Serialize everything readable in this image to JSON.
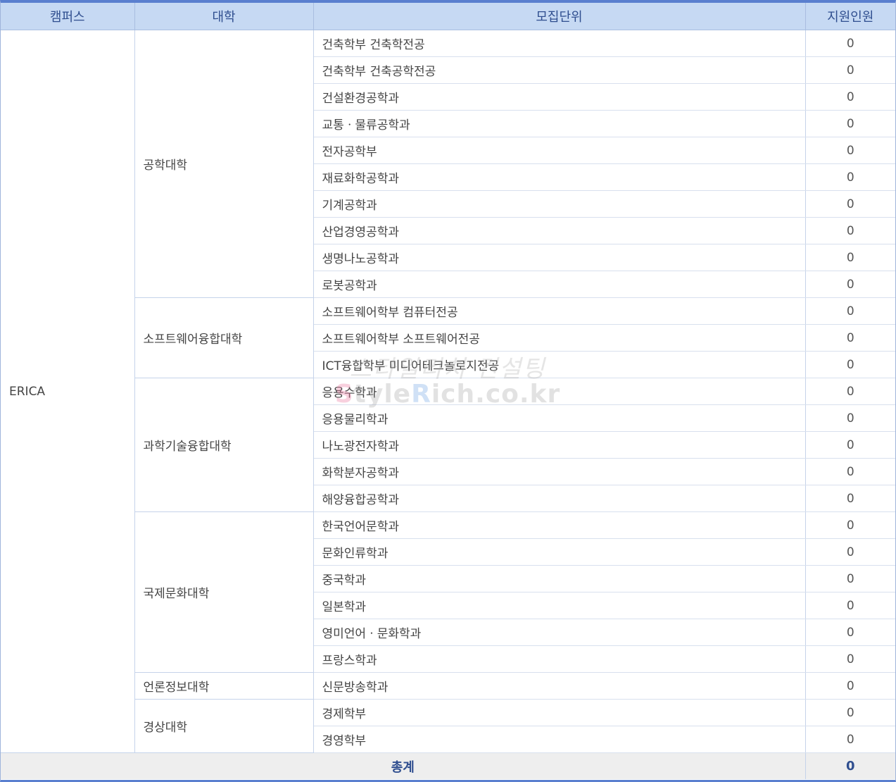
{
  "header": {
    "campus": "캠퍼스",
    "college": "대학",
    "unit": "모집단위",
    "applicants": "지원인원"
  },
  "campus": "ERICA",
  "colleges": [
    {
      "name": "공학대학",
      "units": [
        {
          "name": "건축학부 건축학전공",
          "count": "0"
        },
        {
          "name": "건축학부 건축공학전공",
          "count": "0"
        },
        {
          "name": "건설환경공학과",
          "count": "0"
        },
        {
          "name": "교통ㆍ물류공학과",
          "count": "0"
        },
        {
          "name": "전자공학부",
          "count": "0"
        },
        {
          "name": "재료화학공학과",
          "count": "0"
        },
        {
          "name": "기계공학과",
          "count": "0"
        },
        {
          "name": "산업경영공학과",
          "count": "0"
        },
        {
          "name": "생명나노공학과",
          "count": "0"
        },
        {
          "name": "로봇공학과",
          "count": "0"
        }
      ]
    },
    {
      "name": "소프트웨어융합대학",
      "units": [
        {
          "name": "소프트웨어학부 컴퓨터전공",
          "count": "0"
        },
        {
          "name": "소프트웨어학부 소프트웨어전공",
          "count": "0"
        },
        {
          "name": "ICT융합학부 미디어테크놀로지전공",
          "count": "0"
        }
      ]
    },
    {
      "name": "과학기술융합대학",
      "units": [
        {
          "name": "응용수학과",
          "count": "0"
        },
        {
          "name": "응용물리학과",
          "count": "0"
        },
        {
          "name": "나노광전자학과",
          "count": "0"
        },
        {
          "name": "화학분자공학과",
          "count": "0"
        },
        {
          "name": "해양융합공학과",
          "count": "0"
        }
      ]
    },
    {
      "name": "국제문화대학",
      "units": [
        {
          "name": "한국언어문학과",
          "count": "0"
        },
        {
          "name": "문화인류학과",
          "count": "0"
        },
        {
          "name": "중국학과",
          "count": "0"
        },
        {
          "name": "일본학과",
          "count": "0"
        },
        {
          "name": "영미언어ㆍ문화학과",
          "count": "0"
        },
        {
          "name": "프랑스학과",
          "count": "0"
        }
      ]
    },
    {
      "name": "언론정보대학",
      "units": [
        {
          "name": "신문방송학과",
          "count": "0"
        }
      ]
    },
    {
      "name": "경상대학",
      "units": [
        {
          "name": "경제학부",
          "count": "0"
        },
        {
          "name": "경영학부",
          "count": "0"
        }
      ]
    }
  ],
  "total": {
    "label": "총계",
    "count": "0"
  },
  "watermark": {
    "top": "스타일리치 컨설팅",
    "bottom_s": "S",
    "bottom_mid": "tyle",
    "bottom_r": "R",
    "bottom_rest": "ich.co.kr"
  }
}
